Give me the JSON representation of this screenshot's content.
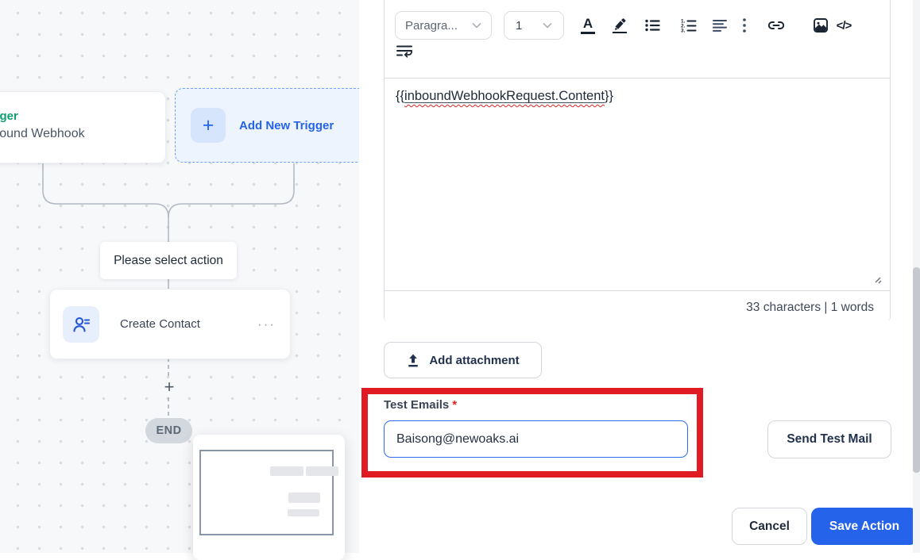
{
  "colors": {
    "accent_blue": "#2563eb",
    "annotation_red": "#e11b23",
    "trigger_green": "#0f9d70"
  },
  "canvas": {
    "trigger_card": {
      "type_label": "Trigger",
      "name": "Inbound Webhook"
    },
    "add_trigger": {
      "plus": "+",
      "label": "Add New Trigger"
    },
    "select_action": "Please select action",
    "create_contact": {
      "label": "Create Contact",
      "menu_dots": "···"
    },
    "plus_connector": "+",
    "end_badge": "END"
  },
  "editor": {
    "paragraph_dropdown": "Paragra...",
    "size_dropdown": "1",
    "text_color_glyph": "A",
    "code_icon_glyph": "</>",
    "content": {
      "open": "{{",
      "token": "inboundWebhookRequest.Content",
      "close": "}}"
    },
    "stats": "33 characters | 1 words"
  },
  "actions": {
    "add_attachment": "Add attachment",
    "test_emails_label": "Test Emails",
    "required_mark": "*",
    "test_email_value": "Baisong@newoaks.ai",
    "send_test_mail": "Send Test Mail",
    "cancel": "Cancel",
    "save_action": "Save Action"
  },
  "icons": {
    "more_vertical": "vertical-ellipsis",
    "chevron": "chevron-down",
    "link": "link",
    "image": "image",
    "upload": "upload-arrow",
    "person": "contact-person"
  }
}
